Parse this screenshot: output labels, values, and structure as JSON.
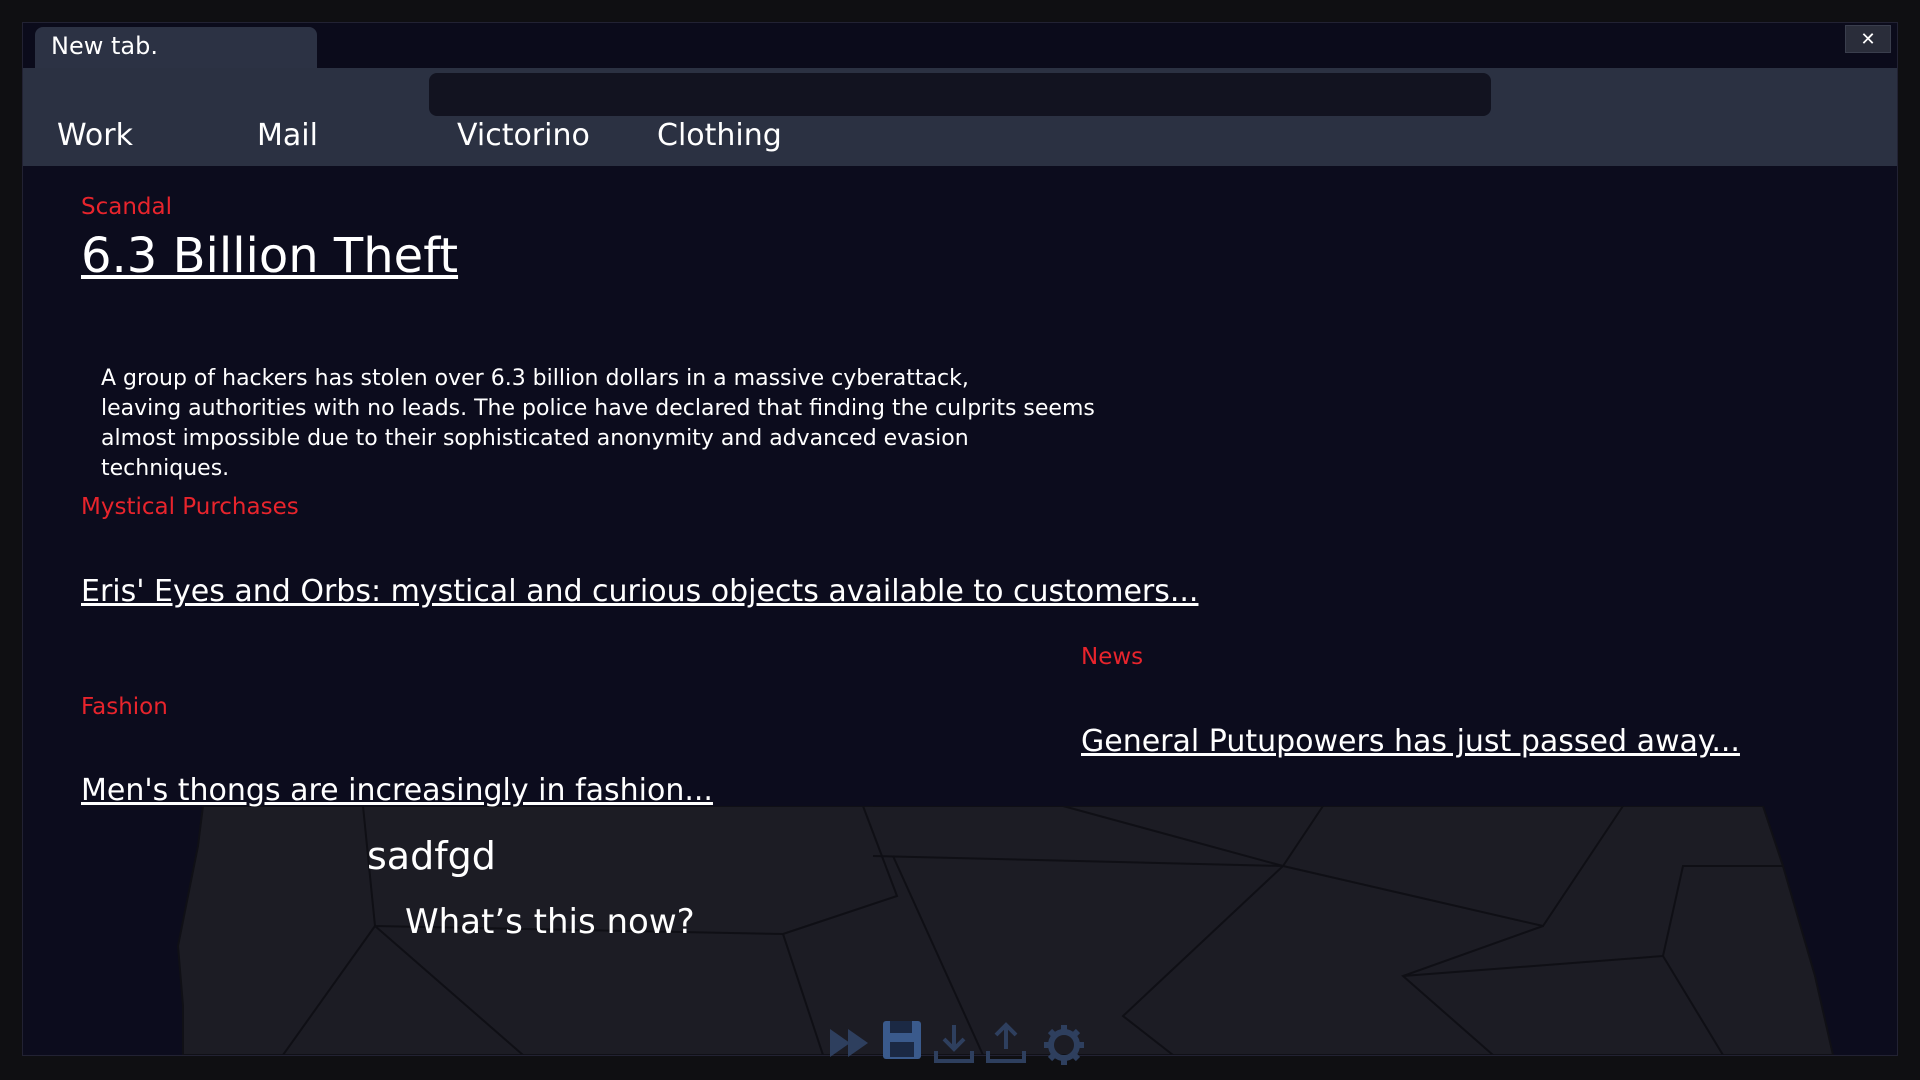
{
  "tab": {
    "title": "New tab."
  },
  "window": {
    "close_label": "✕"
  },
  "urlbar": {
    "value": "",
    "placeholder": ""
  },
  "bookmarks": [
    {
      "label": "Work"
    },
    {
      "label": "Mail"
    },
    {
      "label": "Victorino"
    },
    {
      "label": "Clothing"
    }
  ],
  "articles": {
    "scandal": {
      "category": "Scandal",
      "headline": "6.3 Billion Theft",
      "body": [
        "A group of hackers has stolen over 6.3 billion dollars in a massive cyberattack,",
        "leaving authorities with no leads. The police have declared that finding the culprits seems",
        "almost impossible due to their sophisticated anonymity and advanced evasion techniques."
      ]
    },
    "mystical": {
      "category": "Mystical Purchases",
      "headline": "Eris' Eyes and Orbs: mystical and curious objects available to customers..."
    },
    "fashion": {
      "category": "Fashion",
      "headline": "Men's thongs are increasingly in fashion..."
    },
    "news": {
      "category": "News",
      "headline": "General Putupowers has just passed away..."
    }
  },
  "dialogue": {
    "speaker": "sadfgd",
    "line": "What’s this now?"
  },
  "colors": {
    "accent_red": "#e8242c",
    "window_bg": "#0c0c1d",
    "toolbar_bg": "#2b3142",
    "icon_blue": "#3a5a8c"
  },
  "quick_menu": [
    {
      "icon": "fast-forward-icon"
    },
    {
      "icon": "save-icon"
    },
    {
      "icon": "load-icon"
    },
    {
      "icon": "upload-icon"
    },
    {
      "icon": "settings-gear-icon"
    }
  ]
}
